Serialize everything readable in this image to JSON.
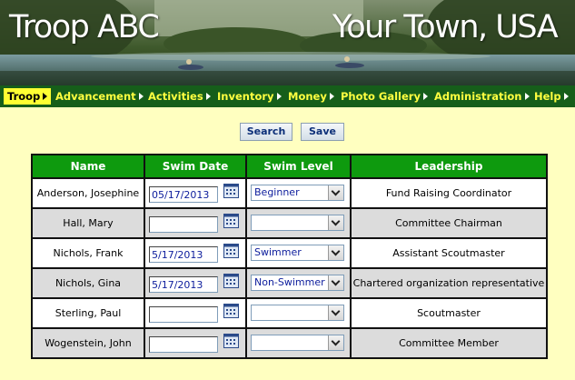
{
  "header": {
    "troop_title": "Troop ABC",
    "town_title": "Your Town, USA"
  },
  "nav": {
    "items": [
      {
        "label": "Troop",
        "active": true
      },
      {
        "label": "Advancement",
        "active": false
      },
      {
        "label": "Activities",
        "active": false
      },
      {
        "label": "Inventory",
        "active": false
      },
      {
        "label": "Money",
        "active": false
      },
      {
        "label": "Photo Gallery",
        "active": false
      },
      {
        "label": "Administration",
        "active": false
      },
      {
        "label": "Help",
        "active": false
      }
    ]
  },
  "toolbar": {
    "search_label": "Search",
    "save_label": "Save"
  },
  "table": {
    "headers": [
      "Name",
      "Swim Date",
      "Swim Level",
      "Leadership"
    ],
    "rows": [
      {
        "name": "Anderson, Josephine",
        "swim_date": "05/17/2013",
        "swim_level": "Beginner",
        "leadership": "Fund Raising Coordinator"
      },
      {
        "name": "Hall, Mary",
        "swim_date": "",
        "swim_level": "",
        "leadership": "Committee Chairman"
      },
      {
        "name": "Nichols, Frank",
        "swim_date": "5/17/2013",
        "swim_level": "Swimmer",
        "leadership": "Assistant Scoutmaster"
      },
      {
        "name": "Nichols, Gina",
        "swim_date": "5/17/2013",
        "swim_level": "Non-Swimmer",
        "leadership": "Chartered organization representative"
      },
      {
        "name": "Sterling, Paul",
        "swim_date": "",
        "swim_level": "",
        "leadership": "Scoutmaster"
      },
      {
        "name": "Wogenstein, John",
        "swim_date": "",
        "swim_level": "",
        "leadership": "Committee Member"
      }
    ]
  },
  "icons": {
    "calendar": "calendar-icon",
    "dropdown": "chevron-down-icon",
    "nav_arrow": "triangle-right-icon"
  },
  "colors": {
    "nav_background": "#165e1a",
    "nav_text": "#ffff40",
    "nav_active_background": "#ffff33",
    "table_header": "#0e9a0e",
    "page_background": "#ffffc0",
    "alt_row": "#dcdcdc"
  }
}
